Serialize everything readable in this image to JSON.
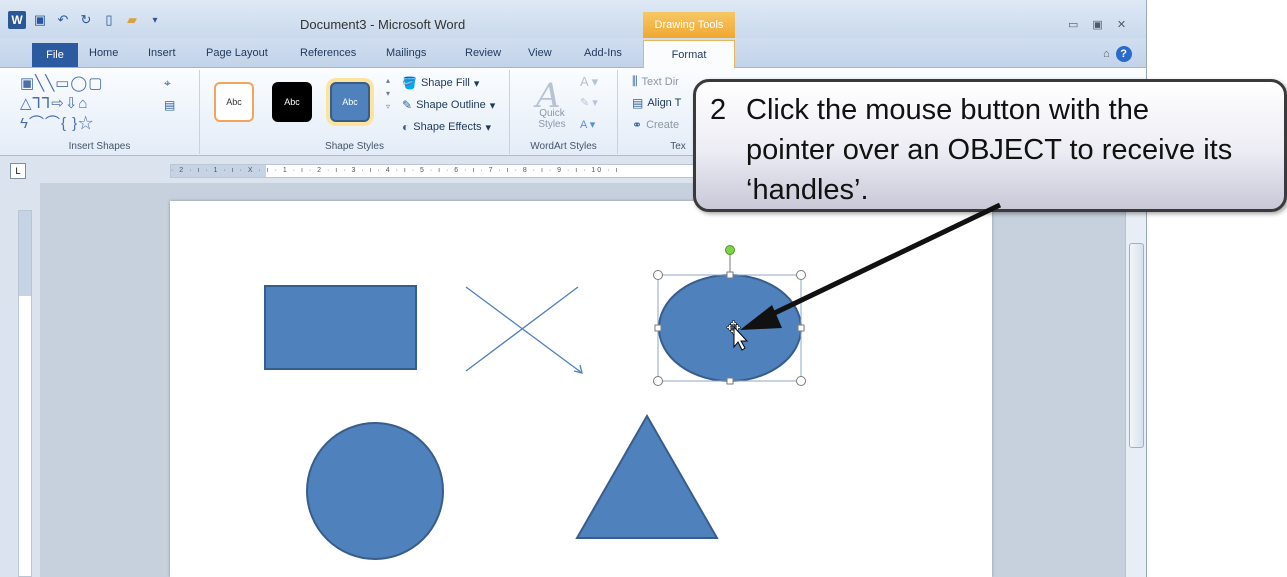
{
  "app": {
    "title": "Document3  -  Microsoft Word",
    "contextual_tab": "Drawing Tools"
  },
  "tabs": [
    "File",
    "Home",
    "Insert",
    "Page Layout",
    "References",
    "Mailings",
    "Review",
    "View",
    "Add-Ins",
    "Format"
  ],
  "ribbon": {
    "groups": {
      "insert_shapes": "Insert Shapes",
      "shape_styles": "Shape Styles",
      "wordart_styles": "WordArt Styles",
      "text": "Tex"
    },
    "style_thumbs": [
      "Abc",
      "Abc",
      "Abc"
    ],
    "shape_fill": "Shape Fill",
    "shape_outline": "Shape Outline",
    "shape_effects": "Shape Effects",
    "quick_styles": "Quick Styles",
    "text_direction": "Text Dir",
    "align_text": "Align T",
    "create_link": "Create"
  },
  "ruler": {
    "corner": "L",
    "marks": "· 2 · ı · 1 · ı · X · ı · 1 · ı · 2 · ı · 3 · ı · 4 · ı · 5 · ı · 6 · ı · 7 · ı · 8 · ı · 9 · ı · 10 · ı"
  },
  "callout": {
    "number": "2",
    "line1": "Click the mouse button with the",
    "line2": "pointer over an OBJECT to receive its",
    "line3": "‘handles’."
  },
  "colors": {
    "shape_fill": "#4f81bd",
    "shape_outline": "#385d8a",
    "accent": "#2b579a"
  },
  "icons": [
    "word-icon",
    "save-icon",
    "undo-icon",
    "redo-icon",
    "new-document-icon",
    "open-folder-icon",
    "minimize-icon",
    "restore-icon",
    "close-icon",
    "help-icon",
    "move-cursor-icon"
  ]
}
